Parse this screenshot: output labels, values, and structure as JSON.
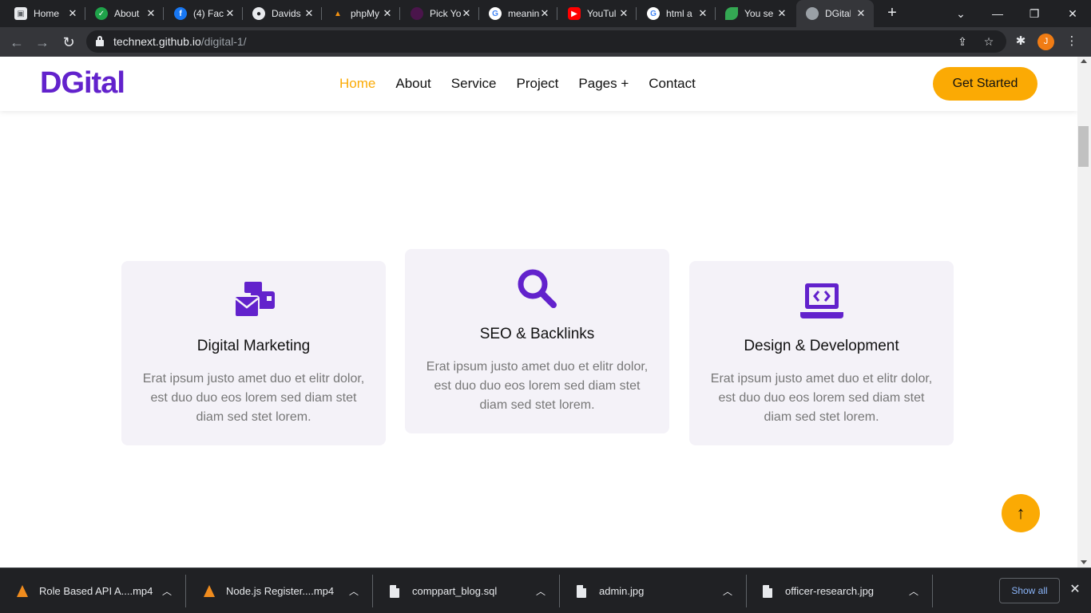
{
  "browser": {
    "tabs": [
      {
        "title": "Home",
        "favicon": "page-icon",
        "color": "#9aa0a6"
      },
      {
        "title": "About",
        "favicon": "check-icon",
        "color": "#1fa34a"
      },
      {
        "title": "(4) Fac",
        "favicon": "facebook-icon",
        "color": "#1877f2"
      },
      {
        "title": "Davids",
        "favicon": "github-icon",
        "color": "#e8eaed"
      },
      {
        "title": "phpMy",
        "favicon": "phpmyadmin-icon",
        "color": "#f29111"
      },
      {
        "title": "Pick Yo",
        "favicon": "app-icon",
        "color": "#4a154b"
      },
      {
        "title": "meanin",
        "favicon": "google-icon",
        "color": "#4285f4"
      },
      {
        "title": "YouTul",
        "favicon": "youtube-icon",
        "color": "#ff0000"
      },
      {
        "title": "html a",
        "favicon": "google-icon",
        "color": "#4285f4"
      },
      {
        "title": "You se",
        "favicon": "leaf-icon",
        "color": "#34a853"
      },
      {
        "title": "DGital",
        "favicon": "globe-icon",
        "color": "#9aa0a6"
      }
    ],
    "new_tab": "+",
    "url_host": "technext.github.io",
    "url_path": "/digital-1/",
    "profile_initial": "J"
  },
  "site": {
    "logo": "DGital",
    "nav": [
      "Home",
      "About",
      "Service",
      "Project",
      "Pages +",
      "Contact"
    ],
    "cta": "Get Started",
    "accent": "#fbaa04",
    "brand": "#6222cc"
  },
  "services": [
    {
      "title": "Digital Marketing",
      "icon": "mail-bulk-icon",
      "text": "Erat ipsum justo amet duo et elitr dolor, est duo duo eos lorem sed diam stet diam sed stet lorem."
    },
    {
      "title": "SEO & Backlinks",
      "icon": "search-icon",
      "text": "Erat ipsum justo amet duo et elitr dolor, est duo duo eos lorem sed diam stet diam sed stet lorem."
    },
    {
      "title": "Design & Development",
      "icon": "laptop-code-icon",
      "text": "Erat ipsum justo amet duo et elitr dolor, est duo duo eos lorem sed diam stet diam sed stet lorem."
    }
  ],
  "back_to_top": "↑",
  "downloads": {
    "items": [
      {
        "name": "Role Based API A....mp4",
        "icon": "vlc-icon"
      },
      {
        "name": "Node.js Register....mp4",
        "icon": "vlc-icon"
      },
      {
        "name": "comppart_blog.sql",
        "icon": "file-icon"
      },
      {
        "name": "admin.jpg",
        "icon": "image-file-icon"
      },
      {
        "name": "officer-research.jpg",
        "icon": "image-file-icon"
      }
    ],
    "show_all": "Show all"
  }
}
